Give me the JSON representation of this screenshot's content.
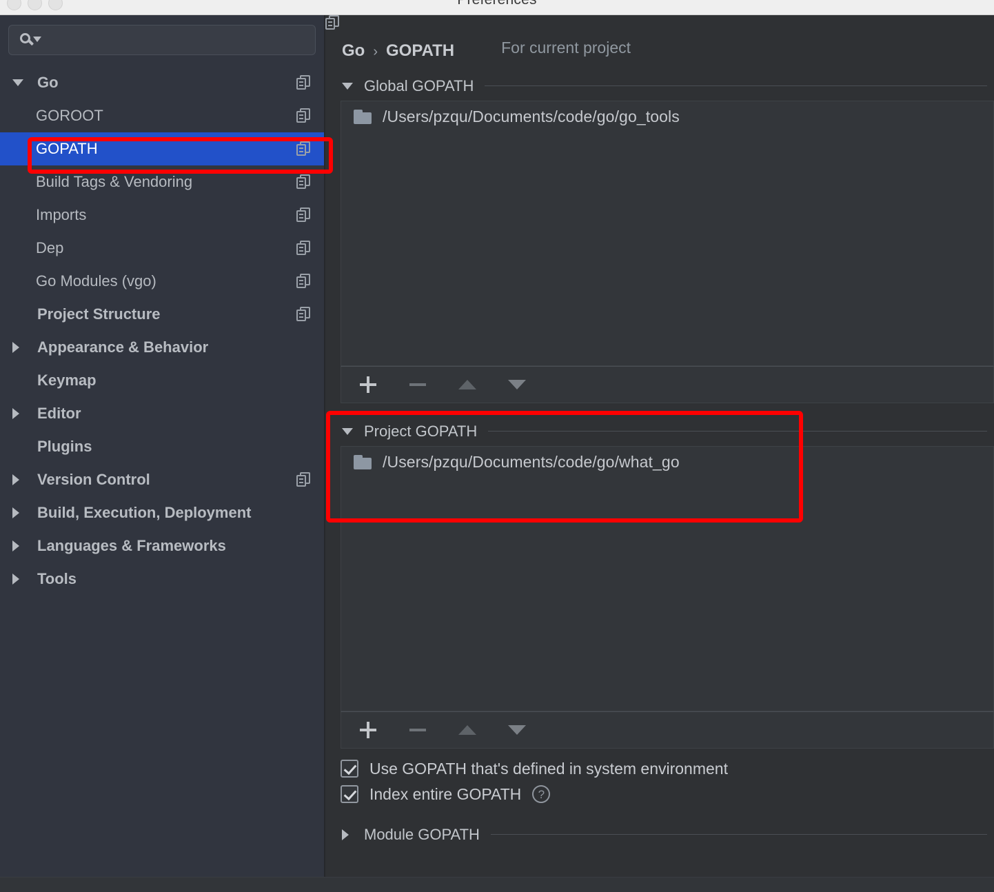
{
  "window": {
    "title": "Preferences",
    "traffic_lights": [
      "close-button",
      "minimize-button",
      "zoom-button"
    ]
  },
  "sidebar": {
    "search": {
      "value": "",
      "placeholder": "",
      "icon": "search-icon"
    },
    "items": [
      {
        "label": "Go",
        "level": 0,
        "arrow": "down",
        "bold": true,
        "copy": true,
        "selected": false
      },
      {
        "label": "GOROOT",
        "level": 1,
        "arrow": "none",
        "bold": false,
        "copy": true,
        "selected": false
      },
      {
        "label": "GOPATH",
        "level": 1,
        "arrow": "none",
        "bold": false,
        "copy": true,
        "selected": true
      },
      {
        "label": "Build Tags & Vendoring",
        "level": 1,
        "arrow": "none",
        "bold": false,
        "copy": true,
        "selected": false
      },
      {
        "label": "Imports",
        "level": 1,
        "arrow": "none",
        "bold": false,
        "copy": true,
        "selected": false
      },
      {
        "label": "Dep",
        "level": 1,
        "arrow": "none",
        "bold": false,
        "copy": true,
        "selected": false
      },
      {
        "label": "Go Modules (vgo)",
        "level": 1,
        "arrow": "none",
        "bold": false,
        "copy": true,
        "selected": false
      },
      {
        "label": "Project Structure",
        "level": 0,
        "arrow": "none",
        "bold": true,
        "copy": true,
        "selected": false
      },
      {
        "label": "Appearance & Behavior",
        "level": 0,
        "arrow": "right",
        "bold": true,
        "copy": false,
        "selected": false
      },
      {
        "label": "Keymap",
        "level": 0,
        "arrow": "none",
        "bold": true,
        "copy": false,
        "selected": false
      },
      {
        "label": "Editor",
        "level": 0,
        "arrow": "right",
        "bold": true,
        "copy": false,
        "selected": false
      },
      {
        "label": "Plugins",
        "level": 0,
        "arrow": "none",
        "bold": true,
        "copy": false,
        "selected": false
      },
      {
        "label": "Version Control",
        "level": 0,
        "arrow": "right",
        "bold": true,
        "copy": true,
        "selected": false
      },
      {
        "label": "Build, Execution, Deployment",
        "level": 0,
        "arrow": "right",
        "bold": true,
        "copy": false,
        "selected": false
      },
      {
        "label": "Languages & Frameworks",
        "level": 0,
        "arrow": "right",
        "bold": true,
        "copy": false,
        "selected": false
      },
      {
        "label": "Tools",
        "level": 0,
        "arrow": "right",
        "bold": true,
        "copy": false,
        "selected": false
      }
    ]
  },
  "main": {
    "breadcrumb": {
      "root": "Go",
      "separator": "›",
      "current": "GOPATH"
    },
    "scope": {
      "label": "For current project",
      "icon": "copy-icon"
    },
    "global_section": {
      "title": "Global GOPATH",
      "expanded": true,
      "entries": [
        {
          "path": "/Users/pzqu/Documents/code/go/go_tools",
          "icon": "folder-icon"
        }
      ],
      "toolbar": {
        "add": "+",
        "remove": "−",
        "move_up": "▲",
        "move_down": "▼"
      }
    },
    "project_section": {
      "title": "Project GOPATH",
      "expanded": true,
      "entries": [
        {
          "path": "/Users/pzqu/Documents/code/go/what_go",
          "icon": "folder-icon"
        }
      ],
      "toolbar": {
        "add": "+",
        "remove": "−",
        "move_up": "▲",
        "move_down": "▼"
      }
    },
    "checkboxes": [
      {
        "label": "Use GOPATH that's defined in system environment",
        "checked": true,
        "help": false
      },
      {
        "label": "Index entire GOPATH",
        "checked": true,
        "help": true,
        "help_glyph": "?"
      }
    ],
    "module_section": {
      "title": "Module GOPATH",
      "expanded": false
    }
  },
  "annotations": {
    "color": "#ff0000",
    "boxes": [
      {
        "name": "gopath-sidebar-highlight"
      },
      {
        "name": "project-gopath-highlight"
      }
    ]
  },
  "colors": {
    "selection_blue": "#2251c9",
    "sidebar_bg": "#31353f",
    "main_bg": "#2f3134",
    "panel_bg": "#33363a",
    "accent_red": "#ff0000"
  }
}
